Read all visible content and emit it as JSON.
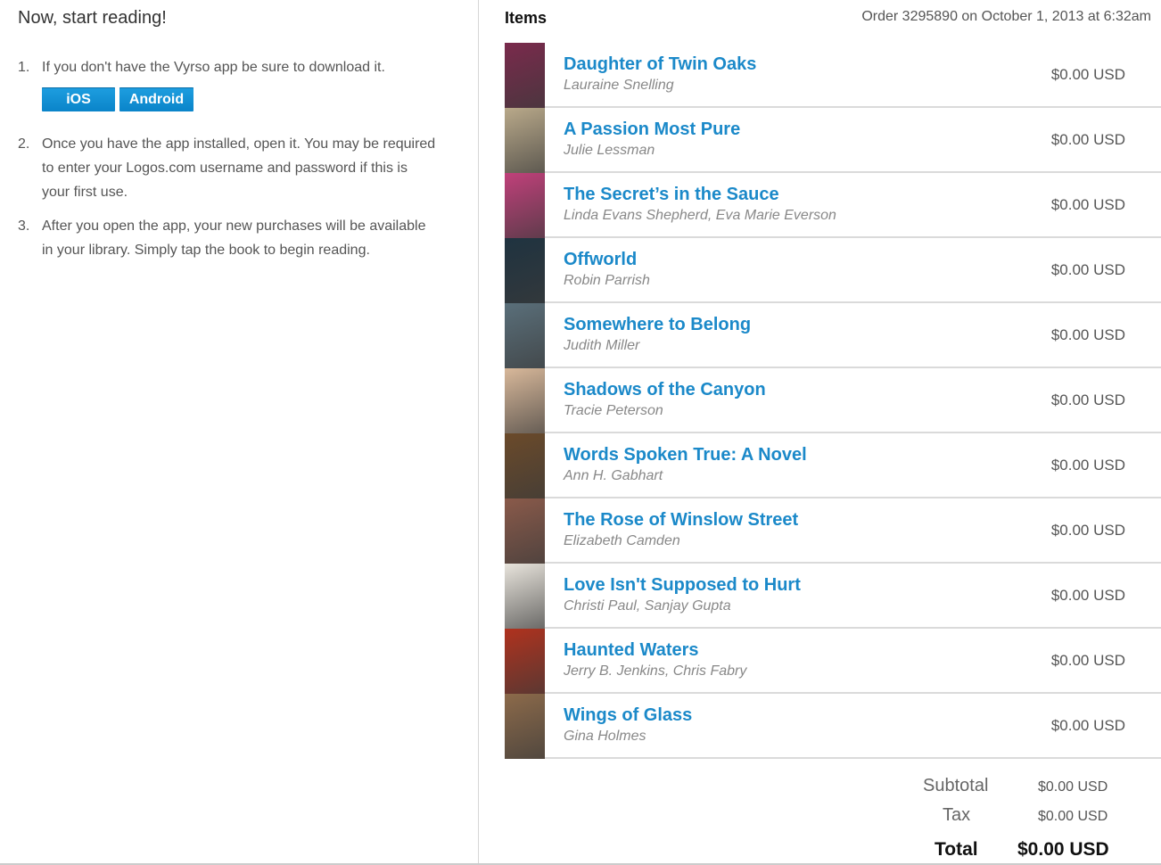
{
  "left": {
    "title": "Now, start reading!",
    "steps": [
      {
        "num": "1.",
        "text": "If you don't have the Vyrso app be sure to download it."
      },
      {
        "num": "2.",
        "text": "Once you have the app installed, open it. You may be required to enter your Logos.com username and password if this is your first use."
      },
      {
        "num": "3.",
        "text": "After you open the app, your new purchases will be available in your library. Simply tap the book to begin reading."
      }
    ],
    "buttons": {
      "ios": "iOS",
      "android": "Android"
    }
  },
  "right": {
    "items_title": "Items",
    "order_info": "Order 3295890 on October 1, 2013 at 6:32am",
    "items": [
      {
        "title": "Daughter of Twin Oaks",
        "author": "Lauraine Snelling",
        "price": "$0.00 USD",
        "cover_color": "#7a2a4c"
      },
      {
        "title": "A Passion Most Pure",
        "author": "Julie Lessman",
        "price": "$0.00 USD",
        "cover_color": "#b9a98a"
      },
      {
        "title": "The Secret’s in the Sauce",
        "author": "Linda Evans Shepherd, Eva Marie Everson",
        "price": "$0.00 USD",
        "cover_color": "#c0407a"
      },
      {
        "title": "Offworld",
        "author": "Robin Parrish",
        "price": "$0.00 USD",
        "cover_color": "#1f3340"
      },
      {
        "title": "Somewhere to Belong",
        "author": "Judith Miller",
        "price": "$0.00 USD",
        "cover_color": "#5a6f7a"
      },
      {
        "title": "Shadows of the Canyon",
        "author": "Tracie Peterson",
        "price": "$0.00 USD",
        "cover_color": "#d8b89a"
      },
      {
        "title": "Words Spoken True: A Novel",
        "author": "Ann H. Gabhart",
        "price": "$0.00 USD",
        "cover_color": "#6b4a2a"
      },
      {
        "title": "The Rose of Winslow Street",
        "author": "Elizabeth Camden",
        "price": "$0.00 USD",
        "cover_color": "#8a5a4a"
      },
      {
        "title": "Love Isn't Supposed to Hurt",
        "author": "Christi Paul, Sanjay Gupta",
        "price": "$0.00 USD",
        "cover_color": "#e8e4dc"
      },
      {
        "title": "Haunted Waters",
        "author": "Jerry B. Jenkins, Chris Fabry",
        "price": "$0.00 USD",
        "cover_color": "#b0321e"
      },
      {
        "title": "Wings of Glass",
        "author": "Gina Holmes",
        "price": "$0.00 USD",
        "cover_color": "#8c6a4a"
      }
    ],
    "totals": {
      "subtotal_label": "Subtotal",
      "subtotal": "$0.00 USD",
      "tax_label": "Tax",
      "tax": "$0.00 USD",
      "total_label": "Total",
      "total": "$0.00 USD"
    }
  },
  "colors": {
    "link": "#1b89c9",
    "button": "#0a84c9"
  }
}
